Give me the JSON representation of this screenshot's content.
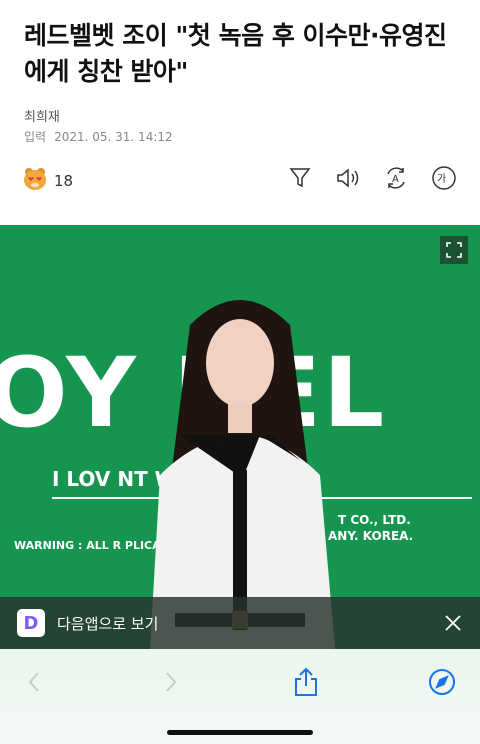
{
  "article": {
    "headline": "레드벨벳 조이 \"첫 녹음 후 이수만·유영진에게 칭찬 받아\"",
    "author": "최희재",
    "date_label": "입력",
    "date_value": "2021. 05. 31. 14:12",
    "reaction_count": "18"
  },
  "toolbar_icons": [
    "filter-icon",
    "speaker-icon",
    "translate-icon",
    "font-size-icon"
  ],
  "font_icon_text": "가",
  "translate_icon_text": "A",
  "photo": {
    "bg_color": "#169551",
    "text_big": "OY HEL",
    "text_mid": "I LOV                         NT WITH YO",
    "text_small1": "T CO., LTD.",
    "text_small2": "ANY. KOREA.",
    "text_small3": "WARNING : ALL R                              PLICATION & RENT IS P"
  },
  "banner": {
    "text": "다음앱으로 보기",
    "logo_letter": "D"
  },
  "browser": {
    "accent": "#1a73e8"
  }
}
